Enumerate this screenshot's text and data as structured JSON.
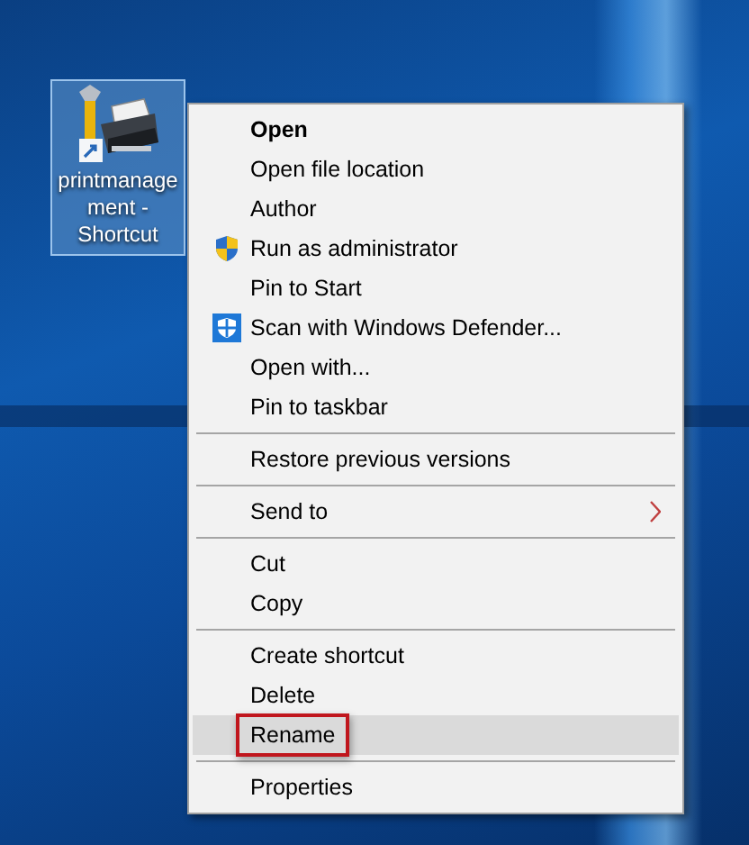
{
  "desktop_icon": {
    "label": "printmanagement - Shortcut",
    "selected": true
  },
  "context_menu": {
    "groups": [
      {
        "items": [
          {
            "label": "Open",
            "default": true,
            "kind": "plain",
            "submenu": false,
            "selected": false,
            "outlined": false
          },
          {
            "label": "Open file location",
            "default": false,
            "kind": "plain",
            "submenu": false,
            "selected": false,
            "outlined": false
          },
          {
            "label": "Author",
            "default": false,
            "kind": "plain",
            "submenu": false,
            "selected": false,
            "outlined": false
          },
          {
            "label": "Run as administrator",
            "default": false,
            "kind": "elevated",
            "submenu": false,
            "selected": false,
            "outlined": false
          },
          {
            "label": "Pin to Start",
            "default": false,
            "kind": "plain",
            "submenu": false,
            "selected": false,
            "outlined": false
          },
          {
            "label": "Scan with Windows Defender...",
            "default": false,
            "kind": "scan",
            "submenu": false,
            "selected": false,
            "outlined": false
          },
          {
            "label": "Open with...",
            "default": false,
            "kind": "plain",
            "submenu": false,
            "selected": false,
            "outlined": false
          },
          {
            "label": "Pin to taskbar",
            "default": false,
            "kind": "plain",
            "submenu": false,
            "selected": false,
            "outlined": false
          }
        ]
      },
      {
        "items": [
          {
            "label": "Restore previous versions",
            "default": false,
            "kind": "plain",
            "submenu": false,
            "selected": false,
            "outlined": false
          }
        ]
      },
      {
        "items": [
          {
            "label": "Send to",
            "default": false,
            "kind": "plain",
            "submenu": true,
            "selected": false,
            "outlined": false
          }
        ]
      },
      {
        "items": [
          {
            "label": "Cut",
            "default": false,
            "kind": "plain",
            "submenu": false,
            "selected": false,
            "outlined": false
          },
          {
            "label": "Copy",
            "default": false,
            "kind": "plain",
            "submenu": false,
            "selected": false,
            "outlined": false
          }
        ]
      },
      {
        "items": [
          {
            "label": "Create shortcut",
            "default": false,
            "kind": "plain",
            "submenu": false,
            "selected": false,
            "outlined": false
          },
          {
            "label": "Delete",
            "default": false,
            "kind": "plain",
            "submenu": false,
            "selected": false,
            "outlined": false
          },
          {
            "label": "Rename",
            "default": false,
            "kind": "plain",
            "submenu": false,
            "selected": true,
            "outlined": true
          }
        ]
      },
      {
        "items": [
          {
            "label": "Properties",
            "default": false,
            "kind": "plain",
            "submenu": false,
            "selected": false,
            "outlined": false
          }
        ]
      }
    ]
  }
}
